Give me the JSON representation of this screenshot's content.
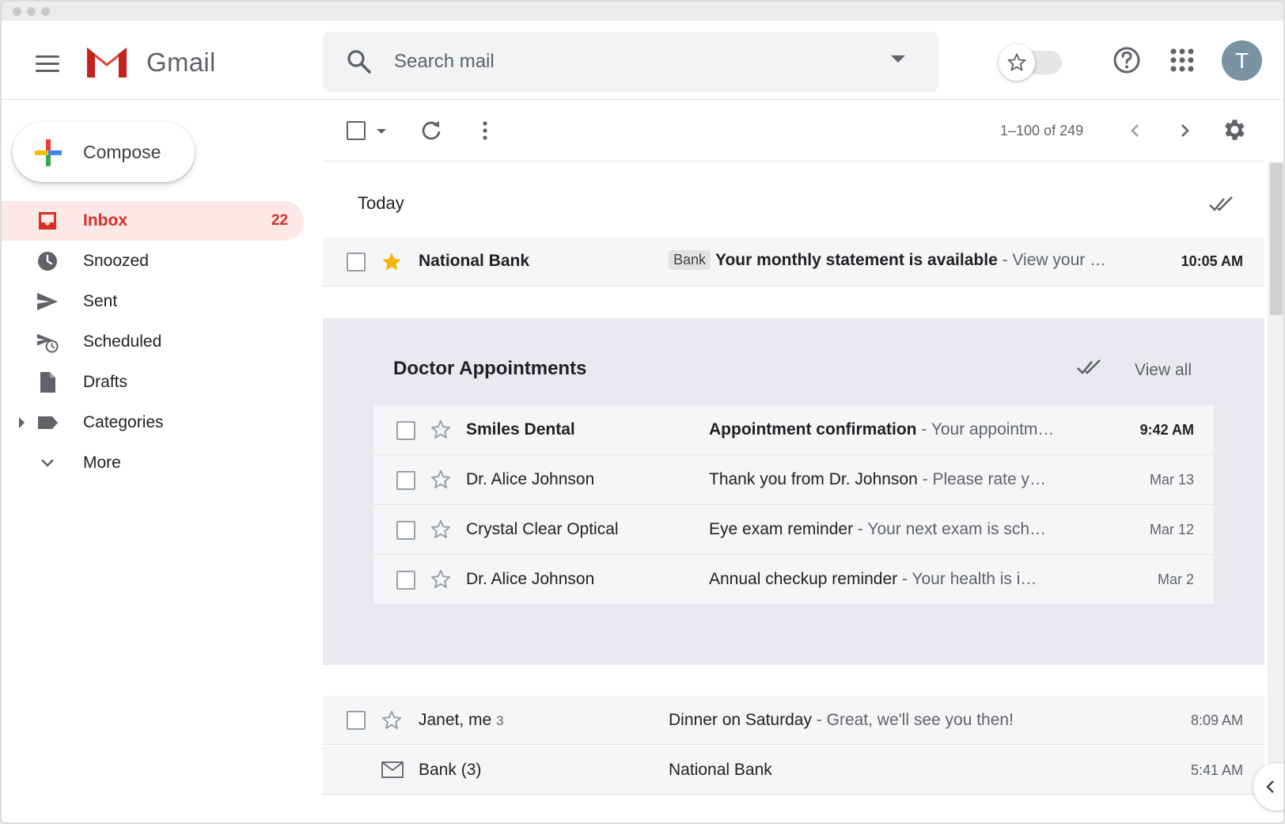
{
  "app": {
    "name": "Gmail",
    "avatar_initial": "T"
  },
  "search": {
    "placeholder": "Search mail"
  },
  "sidebar": {
    "compose_label": "Compose",
    "items": [
      {
        "label": "Inbox",
        "count": "22",
        "active": true
      },
      {
        "label": "Snoozed"
      },
      {
        "label": "Sent"
      },
      {
        "label": "Scheduled"
      },
      {
        "label": "Drafts"
      },
      {
        "label": "Categories"
      },
      {
        "label": "More"
      }
    ]
  },
  "toolbar": {
    "page_count": "1–100 of 249"
  },
  "sections": {
    "today": "Today"
  },
  "today_rows": [
    {
      "sender": "National Bank",
      "label": "Bank",
      "subject": "Your monthly statement is available",
      "snippet": " - View your …",
      "time": "10:05 AM",
      "starred": true,
      "unread": true
    }
  ],
  "bundle": {
    "title": "Doctor Appointments",
    "view_all": "View all",
    "rows": [
      {
        "sender": "Smiles Dental",
        "subject": "Appointment confirmation",
        "snippet": " - Your appointm…",
        "time": "9:42 AM",
        "unread": true
      },
      {
        "sender": "Dr. Alice Johnson",
        "subject": "Thank you from Dr. Johnson",
        "snippet": " - Please rate y…",
        "time": "Mar 13",
        "unread": false
      },
      {
        "sender": "Crystal Clear Optical",
        "subject": "Eye exam reminder",
        "snippet": " - Your next exam is sch…",
        "time": "Mar 12",
        "unread": false
      },
      {
        "sender": "Dr. Alice Johnson",
        "subject": "Annual checkup reminder",
        "snippet": " - Your health is i…",
        "time": "Mar 2",
        "unread": false
      }
    ]
  },
  "later_rows": [
    {
      "sender": "Janet, me",
      "thread_count": "3",
      "subject": "Dinner on Saturday",
      "snippet": " - Great, we'll see you then!",
      "time": "8:09 AM"
    },
    {
      "sender": "Bank (3)",
      "subject": "National Bank",
      "snippet": "",
      "time": "5:41 AM"
    }
  ],
  "colors": {
    "accent": "#d93025",
    "active_bg": "#fce8e6",
    "star": "#f4b400",
    "avatar": "#7893a1"
  }
}
